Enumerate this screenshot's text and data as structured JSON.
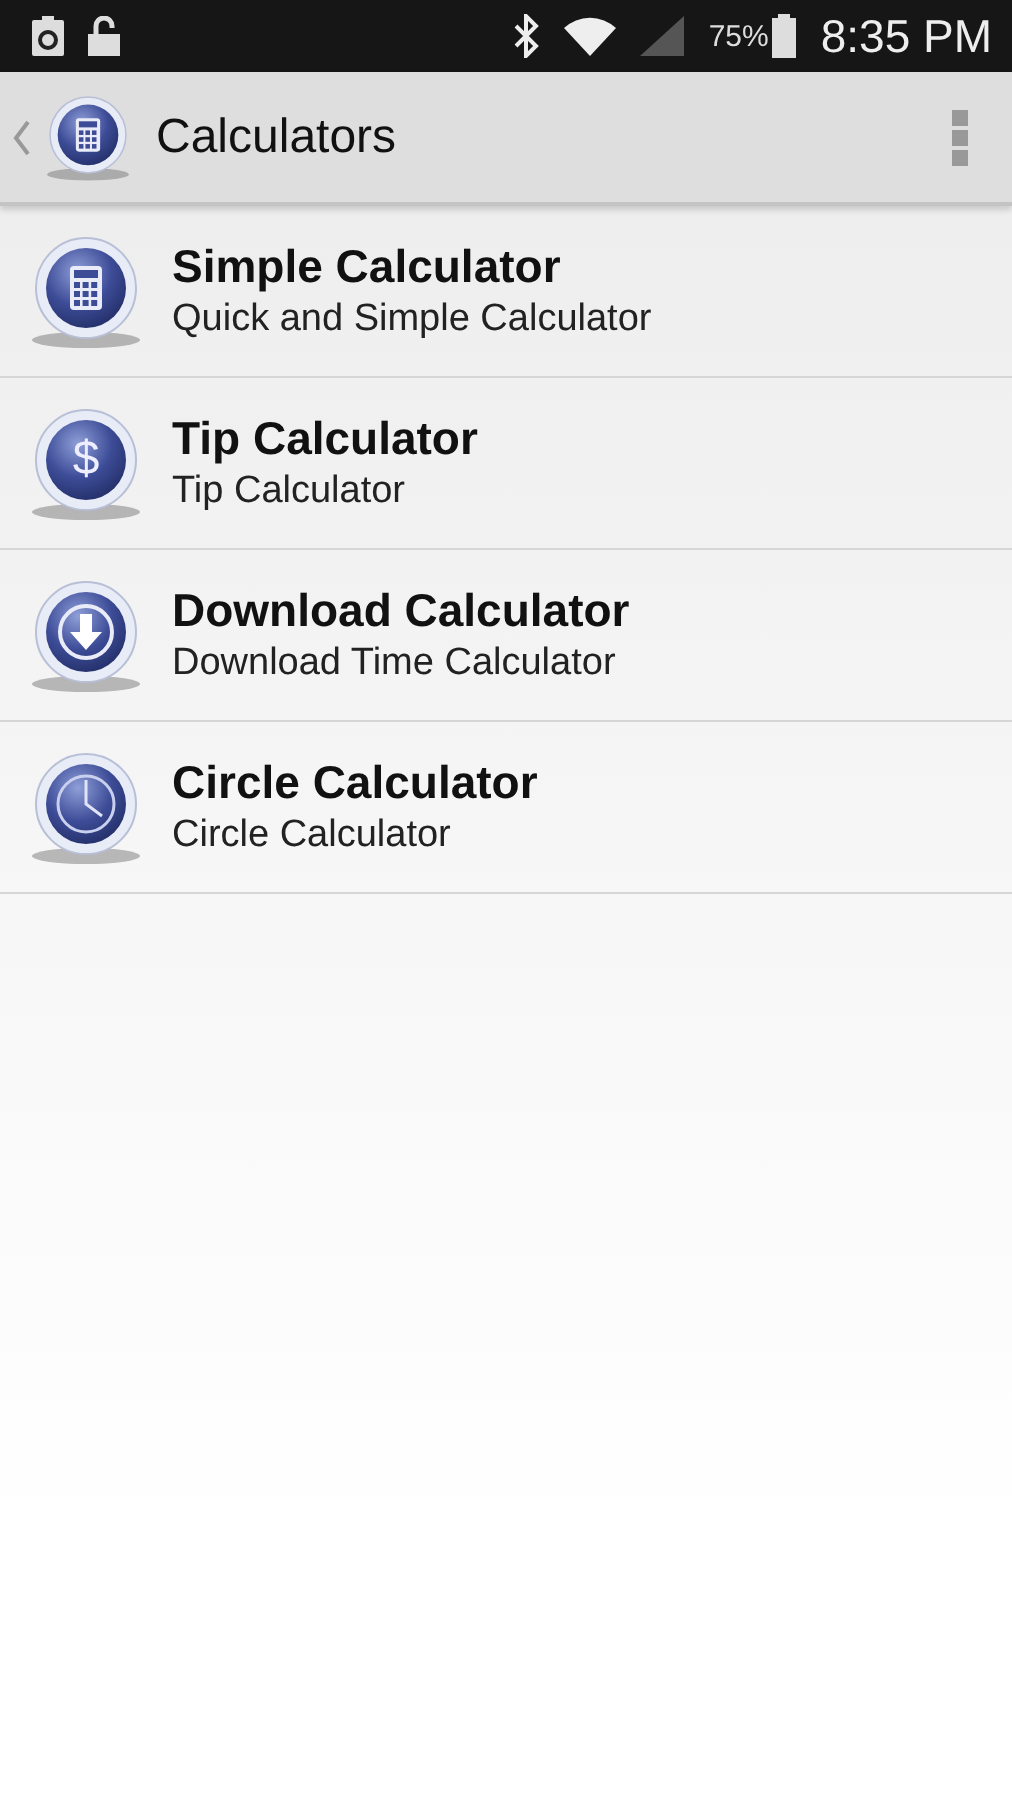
{
  "status_bar": {
    "battery_percent": "75%",
    "time": "8:35 PM"
  },
  "action_bar": {
    "title": "Calculators"
  },
  "items": [
    {
      "kind": "calculator",
      "title": "Simple Calculator",
      "subtitle": "Quick and Simple Calculator"
    },
    {
      "kind": "symbol",
      "symbol": "$",
      "title": "Tip Calculator",
      "subtitle": "Tip Calculator"
    },
    {
      "kind": "download",
      "title": "Download Calculator",
      "subtitle": "Download Time Calculator"
    },
    {
      "kind": "clock",
      "title": "Circle Calculator",
      "subtitle": "Circle Calculator"
    }
  ]
}
